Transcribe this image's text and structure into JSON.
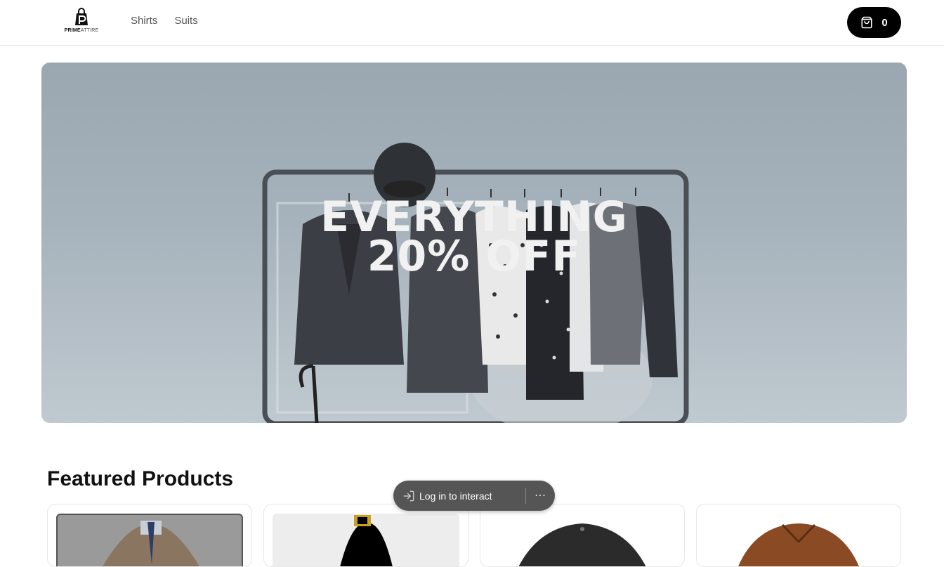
{
  "brand": {
    "name_bold": "PRIME",
    "name_light": "ATTIRE"
  },
  "nav": {
    "items": [
      {
        "label": "Shirts"
      },
      {
        "label": "Suits"
      }
    ]
  },
  "cart": {
    "icon": "shopping-bag-icon",
    "count": "0"
  },
  "hero": {
    "headline": "EVERYTHING 20% OFF"
  },
  "featured": {
    "title": "Featured Products"
  },
  "login_prompt": {
    "label": "Log in to interact",
    "icon": "login-arrow-icon",
    "more_icon": "more-horizontal-icon",
    "more_label": "···"
  },
  "colors": {
    "accent_progress": "#2f6fe0",
    "cart_bg": "#000000",
    "hero_text": "#f1f1f1"
  }
}
